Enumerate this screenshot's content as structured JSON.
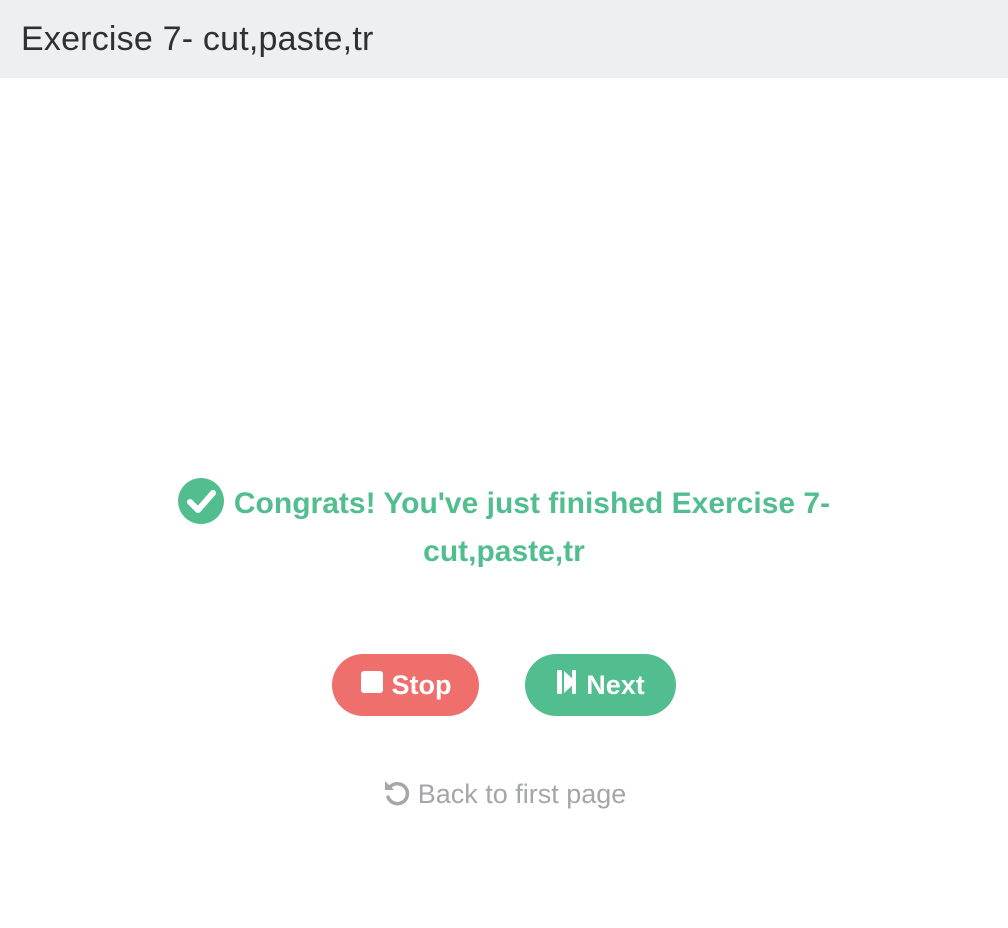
{
  "header": {
    "title": "Exercise 7- cut,paste,tr"
  },
  "congrats": {
    "icon": "check-circle-icon",
    "line1": "Congrats! You've just finished Exercise 7-",
    "line2": "cut,paste,tr",
    "color": "#52be8f"
  },
  "buttons": {
    "stop": {
      "label": "Stop",
      "icon": "stop-icon",
      "color": "#ee6f6b"
    },
    "next": {
      "label": "Next",
      "icon": "step-forward-icon",
      "color": "#52be8f"
    }
  },
  "back_link": {
    "label": "Back to first page",
    "icon": "undo-icon"
  }
}
